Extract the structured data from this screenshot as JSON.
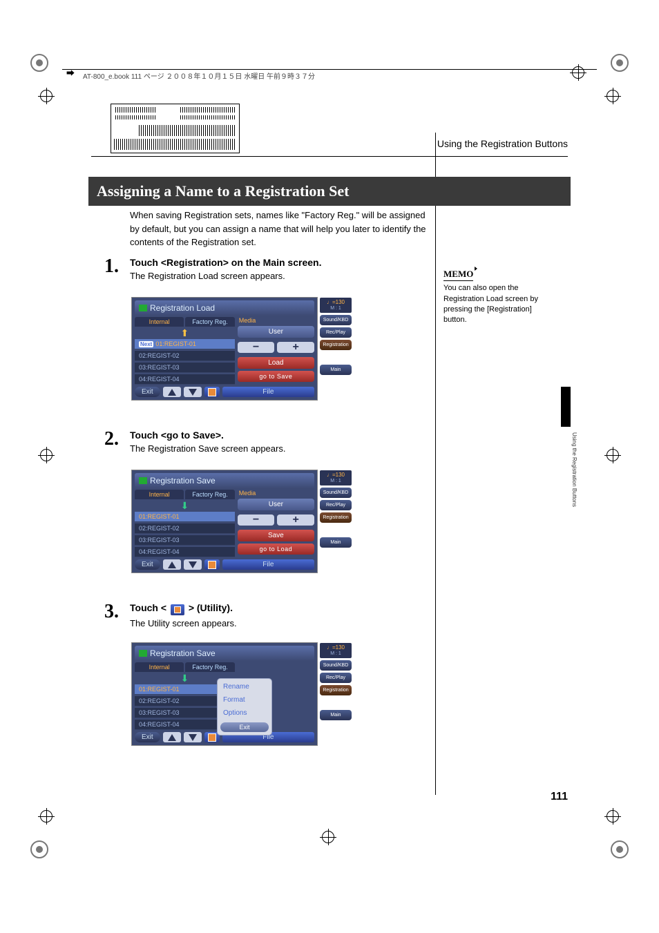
{
  "page": {
    "header_meta": "AT-800_e.book 111 ページ ２００８年１０月１５日 水曜日 午前９時３７分",
    "section_breadcrumb": "Using the Registration Buttons",
    "heading": "Assigning a Name to a Registration Set",
    "intro": "When saving Registration sets, names like \"Factory Reg.\" will be assigned by default, but you can assign a name that will help you later to identify the contents of the Registration set.",
    "page_number": "111",
    "side_tab_text": "Using the Registration Buttons"
  },
  "memo": {
    "label": "MEMO",
    "text": "You can also open the Registration Load screen by pressing the [Registration] button."
  },
  "steps": {
    "s1": {
      "num": "1.",
      "title": "Touch <Registration> on the Main screen.",
      "sub": "The Registration Load screen appears."
    },
    "s2": {
      "num": "2.",
      "title": "Touch <go to Save>.",
      "sub": "The Registration Save screen appears."
    },
    "s3": {
      "num": "3.",
      "title_pre": "Touch < ",
      "title_post": " > (Utility).",
      "sub": "The Utility screen appears."
    }
  },
  "screen_common": {
    "tab_internal": "Internal",
    "tab_factory": "Factory Reg.",
    "media_label": "Media",
    "user_btn": "User",
    "exit_btn": "Exit",
    "file_btn": "File",
    "minus": "−",
    "plus": "+",
    "tempo_label": "♩=130",
    "measure": "M :     1",
    "side_sound": "Sound/KBD",
    "side_rec": "Rec/Play",
    "side_reg": "Registration",
    "side_main": "Main",
    "next_badge": "Next",
    "items": {
      "i1": "01:REGIST-01",
      "i2": "02:REGIST-02",
      "i3": "03:REGIST-03",
      "i4": "04:REGIST-04"
    }
  },
  "screen1": {
    "title": "Registration Load",
    "load_btn": "Load",
    "gotosave_btn": "go to Save"
  },
  "screen2": {
    "title": "Registration Save",
    "save_btn": "Save",
    "gotoload_btn": "go to Load"
  },
  "screen3": {
    "title": "Registration Save",
    "popup": {
      "rename": "Rename",
      "format": "Format",
      "options": "Options",
      "exit": "Exit"
    }
  }
}
